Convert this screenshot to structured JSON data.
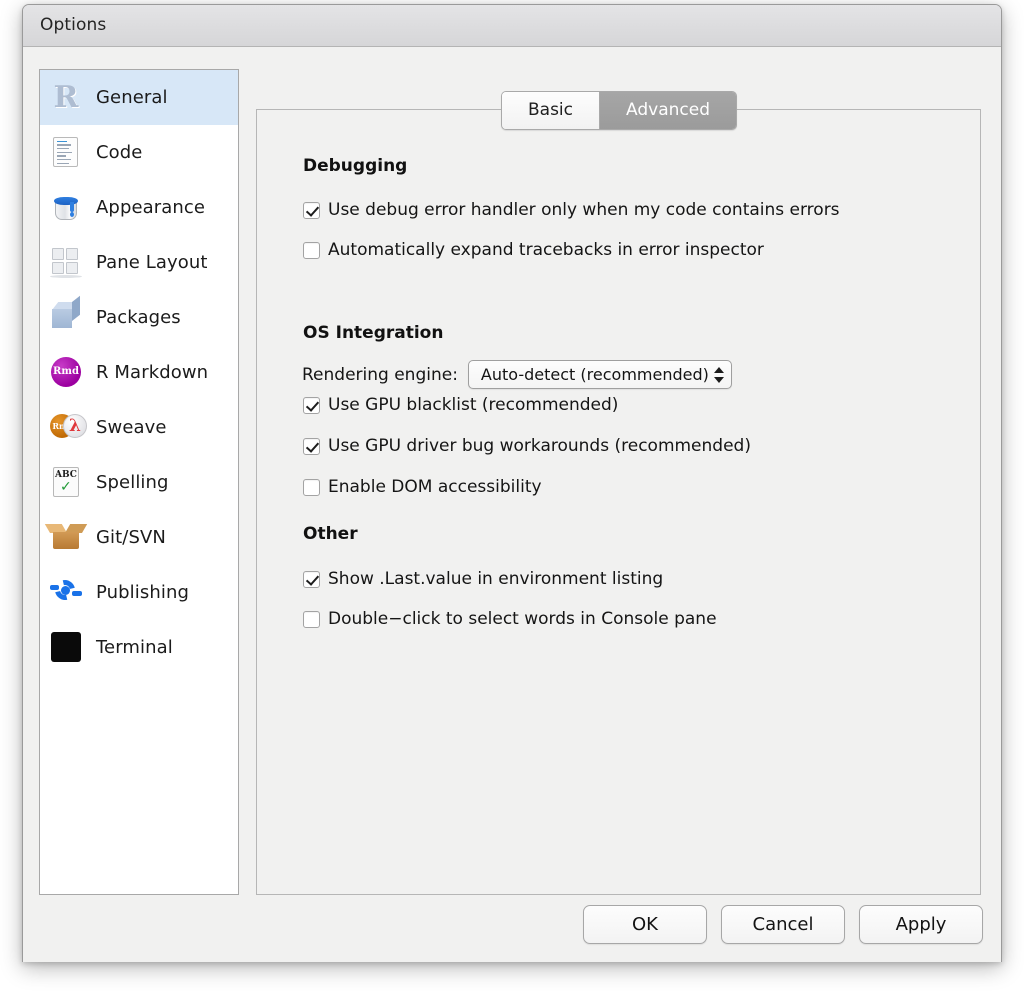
{
  "window": {
    "title": "Options"
  },
  "sidebar": {
    "items": [
      {
        "label": "General",
        "icon": "r-logo-icon",
        "selected": true
      },
      {
        "label": "Code",
        "icon": "code-document-icon",
        "selected": false
      },
      {
        "label": "Appearance",
        "icon": "paint-bucket-icon",
        "selected": false
      },
      {
        "label": "Pane Layout",
        "icon": "pane-grid-icon",
        "selected": false
      },
      {
        "label": "Packages",
        "icon": "package-box-icon",
        "selected": false
      },
      {
        "label": "R Markdown",
        "icon": "rmd-badge-icon",
        "selected": false
      },
      {
        "label": "Sweave",
        "icon": "sweave-pdf-icon",
        "selected": false
      },
      {
        "label": "Spelling",
        "icon": "abc-check-icon",
        "selected": false
      },
      {
        "label": "Git/SVN",
        "icon": "carton-box-icon",
        "selected": false
      },
      {
        "label": "Publishing",
        "icon": "publish-orbit-icon",
        "selected": false
      },
      {
        "label": "Terminal",
        "icon": "terminal-black-icon",
        "selected": false
      }
    ]
  },
  "tabs": [
    {
      "label": "Basic",
      "active": false
    },
    {
      "label": "Advanced",
      "active": true
    }
  ],
  "panel": {
    "debugging": {
      "title": "Debugging",
      "options": [
        {
          "label": "Use debug error handler only when my code contains errors",
          "checked": true
        },
        {
          "label": "Automatically expand tracebacks in error inspector",
          "checked": false
        }
      ]
    },
    "os_integration": {
      "title": "OS Integration",
      "rendering_engine_label": "Rendering engine:",
      "rendering_engine_value": "Auto-detect (recommended)",
      "options": [
        {
          "label": "Use GPU blacklist (recommended)",
          "checked": true
        },
        {
          "label": "Use GPU driver bug workarounds (recommended)",
          "checked": true
        },
        {
          "label": "Enable DOM accessibility",
          "checked": false
        }
      ]
    },
    "other": {
      "title": "Other",
      "options": [
        {
          "label": "Show .Last.value in environment listing",
          "checked": true
        },
        {
          "label": "Double−click to select words in Console pane",
          "checked": false
        }
      ]
    }
  },
  "footer": {
    "buttons": [
      {
        "label": "OK"
      },
      {
        "label": "Cancel"
      },
      {
        "label": "Apply"
      }
    ]
  },
  "colors": {
    "selection_blue": "#d7e7f7",
    "panel_bg": "#f1f1f0",
    "titlebar": "#dcdcde",
    "active_tab": "#a0a0a0"
  }
}
